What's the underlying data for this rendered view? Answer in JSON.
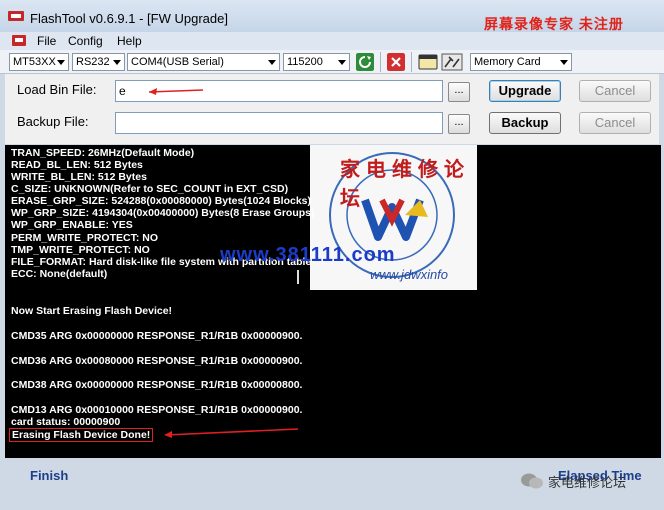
{
  "window": {
    "title": "FlashTool v0.6.9.1 - [FW Upgrade]",
    "watermark": "屏幕录像专家  未注册"
  },
  "menu": [
    "File",
    "Config",
    "Help"
  ],
  "toolbar": {
    "chip": "MT53XX",
    "port_type": "RS232",
    "port": "COM4(USB Serial)",
    "baud": "115200",
    "storage": "Memory Card"
  },
  "load_bin": {
    "label": "Load Bin File:",
    "value": "e",
    "browse": "...",
    "upgrade": "Upgrade",
    "cancel": "Cancel"
  },
  "backup": {
    "label": "Backup File:",
    "value": "",
    "browse": "...",
    "backup": "Backup",
    "cancel": "Cancel"
  },
  "console": {
    "lines": [
      "TRAN_SPEED: 26MHz(Default Mode)",
      "READ_BL_LEN: 512 Bytes",
      "WRITE_BL_LEN: 512 Bytes",
      "C_SIZE: UNKNOWN(Refer to SEC_COUNT in EXT_CSD)",
      "ERASE_GRP_SIZE: 524288(0x00080000) Bytes(1024 Blocks)",
      "WP_GRP_SIZE: 4194304(0x00400000) Bytes(8 Erase Groups)",
      "WP_GRP_ENABLE: YES",
      "PERM_WRITE_PROTECT: NO",
      "TMP_WRITE_PROTECT: NO",
      "FILE_FORMAT: Hard disk-like file system with partition table",
      "ECC: None(default)",
      "Now Start Erasing Flash Device!",
      "CMD35 ARG 0x00000000 RESPONSE_R1/R1B 0x00000900.",
      "CMD36 ARG 0x00080000 RESPONSE_R1/R1B 0x00000900.",
      "CMD38 ARG 0x00000000 RESPONSE_R1/R1B 0x00000800.",
      "CMD13 ARG 0x00010000 RESPONSE_R1/R1B 0x00000900.",
      "card status: 00000900",
      "Erasing Flash Device Done!"
    ],
    "watermark_url": "www.381111.com",
    "watermark_logo_text": "家电维修论坛",
    "watermark_logo_url": "www.jdwxinfo"
  },
  "status": {
    "left": "Finish",
    "right": "Elapsed Time",
    "wechat_label": "家电维修论坛"
  }
}
